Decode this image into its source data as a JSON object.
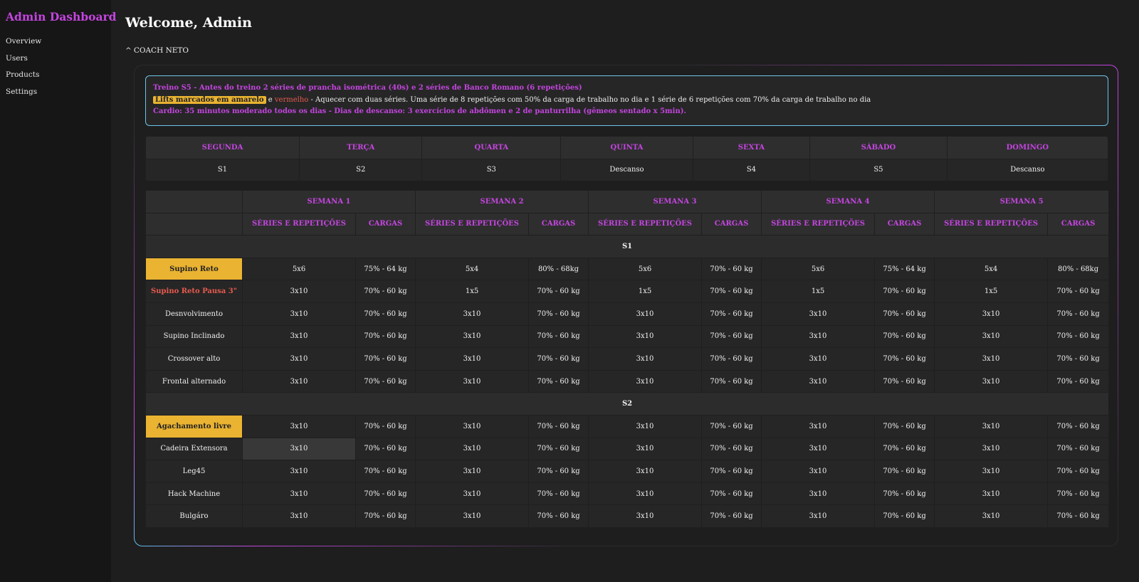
{
  "sidebar": {
    "title": "Admin Dashboard",
    "items": [
      {
        "label": "Overview"
      },
      {
        "label": "Users"
      },
      {
        "label": "Products"
      },
      {
        "label": "Settings"
      }
    ]
  },
  "header": {
    "welcome": "Welcome, Admin",
    "coach_caret": "^",
    "coach_label": "COACH NETO"
  },
  "info": {
    "line1": "Treino S5 - Antes do treino 2 séries de prancha isométrica (40s) e 2 séries de Banco Romano (6 repetições)",
    "badge_yellow": "Lifts marcados em amarelo",
    "connector": " e ",
    "red_word": "vermelho",
    "line2_rest": " - Aquecer com duas séries. Uma série de 8 repetições com 50% da carga de trabalho no dia e 1 série de 6 repetições com 70% da carga de trabalho no dia",
    "line3": "Cardio: 35 minutos moderado todos os dias - Dias de descanso: 3 exercícios de abdômen e 2 de panturrilha (gêmeos sentado x 5min)."
  },
  "days": {
    "headers": [
      "SEGUNDA",
      "TERÇA",
      "QUARTA",
      "QUINTA",
      "SEXTA",
      "SÁBADO",
      "DOMINGO"
    ],
    "values": [
      "S1",
      "S2",
      "S3",
      "Descanso",
      "S4",
      "S5",
      "Descanso"
    ]
  },
  "plan": {
    "weeks": [
      "SEMANA 1",
      "SEMANA 2",
      "SEMANA 3",
      "SEMANA 4",
      "SEMANA 5"
    ],
    "sub_sets": "SÉRIES E REPETIÇÕES",
    "sub_loads": "CARGAS",
    "groups": [
      {
        "name": "S1",
        "rows": [
          {
            "exercise": "Supino Reto",
            "style": "yellow",
            "cells": [
              "5x6",
              "75% - 64 kg",
              "5x4",
              "80% - 68kg",
              "5x6",
              "70% - 60 kg",
              "5x6",
              "75% - 64 kg",
              "5x4",
              "80% - 68kg"
            ]
          },
          {
            "exercise": "Supino Reto Pausa 3\"",
            "style": "red",
            "cells": [
              "3x10",
              "70% - 60 kg",
              "1x5",
              "70% - 60 kg",
              "1x5",
              "70% - 60 kg",
              "1x5",
              "70% - 60 kg",
              "1x5",
              "70% - 60 kg"
            ]
          },
          {
            "exercise": "Desnvolvimento",
            "style": "",
            "cells": [
              "3x10",
              "70% - 60 kg",
              "3x10",
              "70% - 60 kg",
              "3x10",
              "70% - 60 kg",
              "3x10",
              "70% - 60 kg",
              "3x10",
              "70% - 60 kg"
            ]
          },
          {
            "exercise": "Supino Inclinado",
            "style": "",
            "cells": [
              "3x10",
              "70% - 60 kg",
              "3x10",
              "70% - 60 kg",
              "3x10",
              "70% - 60 kg",
              "3x10",
              "70% - 60 kg",
              "3x10",
              "70% - 60 kg"
            ]
          },
          {
            "exercise": "Crossover alto",
            "style": "",
            "cells": [
              "3x10",
              "70% - 60 kg",
              "3x10",
              "70% - 60 kg",
              "3x10",
              "70% - 60 kg",
              "3x10",
              "70% - 60 kg",
              "3x10",
              "70% - 60 kg"
            ]
          },
          {
            "exercise": "Frontal alternado",
            "style": "",
            "cells": [
              "3x10",
              "70% - 60 kg",
              "3x10",
              "70% - 60 kg",
              "3x10",
              "70% - 60 kg",
              "3x10",
              "70% - 60 kg",
              "3x10",
              "70% - 60 kg"
            ]
          }
        ]
      },
      {
        "name": "S2",
        "rows": [
          {
            "exercise": "Agachamento livre",
            "style": "yellow",
            "cells": [
              "3x10",
              "70% - 60 kg",
              "3x10",
              "70% - 60 kg",
              "3x10",
              "70% - 60 kg",
              "3x10",
              "70% - 60 kg",
              "3x10",
              "70% - 60 kg"
            ]
          },
          {
            "exercise": "Cadeira Extensora",
            "style": "",
            "hover_cell": 0,
            "cells": [
              "3x10",
              "70% - 60 kg",
              "3x10",
              "70% - 60 kg",
              "3x10",
              "70% - 60 kg",
              "3x10",
              "70% - 60 kg",
              "3x10",
              "70% - 60 kg"
            ]
          },
          {
            "exercise": "Leg45",
            "style": "",
            "cells": [
              "3x10",
              "70% - 60 kg",
              "3x10",
              "70% - 60 kg",
              "3x10",
              "70% - 60 kg",
              "3x10",
              "70% - 60 kg",
              "3x10",
              "70% - 60 kg"
            ]
          },
          {
            "exercise": "Hack Machine",
            "style": "",
            "cells": [
              "3x10",
              "70% - 60 kg",
              "3x10",
              "70% - 60 kg",
              "3x10",
              "70% - 60 kg",
              "3x10",
              "70% - 60 kg",
              "3x10",
              "70% - 60 kg"
            ]
          },
          {
            "exercise": "Bulgáro",
            "style": "",
            "cells": [
              "3x10",
              "70% - 60 kg",
              "3x10",
              "70% - 60 kg",
              "3x10",
              "70% - 60 kg",
              "3x10",
              "70% - 60 kg",
              "3x10",
              "70% - 60 kg"
            ]
          }
        ]
      }
    ]
  }
}
